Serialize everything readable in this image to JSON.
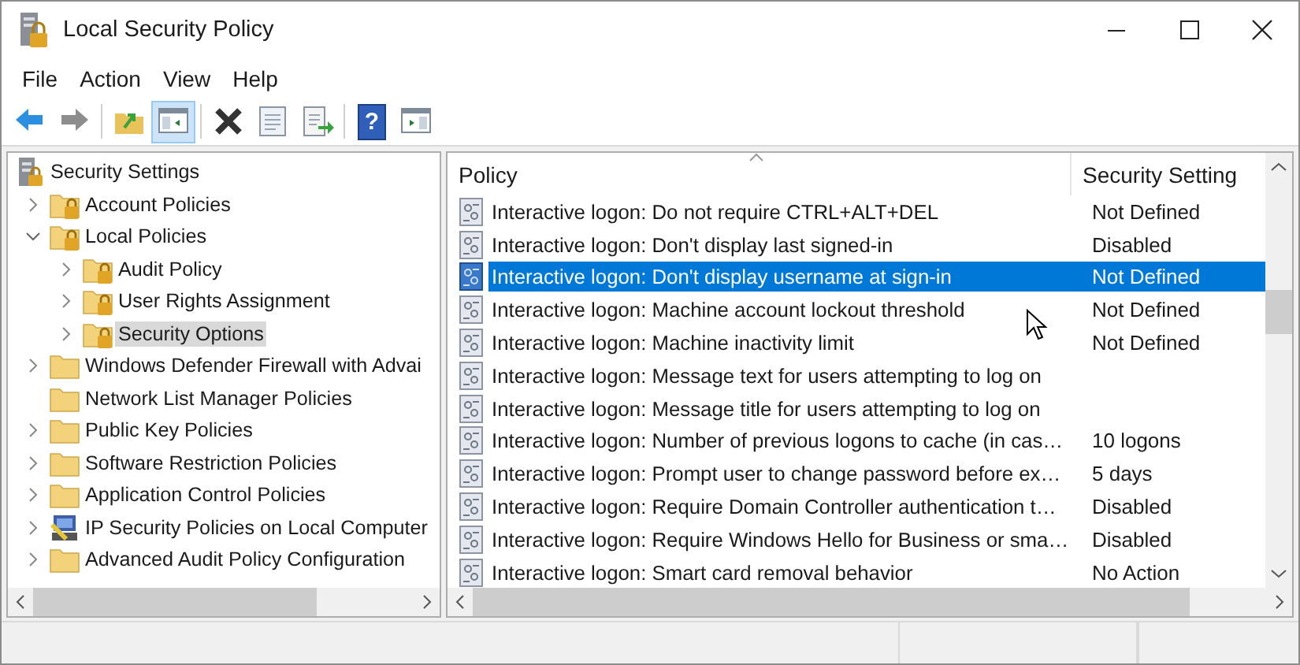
{
  "window": {
    "title": "Local Security Policy"
  },
  "menu": [
    "File",
    "Action",
    "View",
    "Help"
  ],
  "toolbar": [
    {
      "kind": "back",
      "pressed": false
    },
    {
      "kind": "forward",
      "pressed": false
    },
    {
      "kind": "sep"
    },
    {
      "kind": "up",
      "pressed": false
    },
    {
      "kind": "tree",
      "pressed": true
    },
    {
      "kind": "sep"
    },
    {
      "kind": "delete",
      "pressed": false
    },
    {
      "kind": "properties",
      "pressed": false
    },
    {
      "kind": "export",
      "pressed": false
    },
    {
      "kind": "sep"
    },
    {
      "kind": "help",
      "label": "?",
      "pressed": false
    },
    {
      "kind": "pane",
      "pressed": false
    }
  ],
  "tree": [
    {
      "label": "Security Settings",
      "kind": "root",
      "selected": false,
      "children": [
        {
          "label": "Account Policies",
          "kind": "lockfolder",
          "expanded": false,
          "selected": false
        },
        {
          "label": "Local Policies",
          "kind": "lockfolder",
          "expanded": true,
          "selected": false,
          "children": [
            {
              "label": "Audit Policy",
              "kind": "lockfolder",
              "expanded": false,
              "selected": false
            },
            {
              "label": "User Rights Assignment",
              "kind": "lockfolder",
              "expanded": false,
              "selected": false
            },
            {
              "label": "Security Options",
              "kind": "lockfolder",
              "expanded": false,
              "selected": true
            }
          ]
        },
        {
          "label": "Windows Defender Firewall with Advai",
          "kind": "folder",
          "expanded": false,
          "selected": false
        },
        {
          "label": "Network List Manager Policies",
          "kind": "folder",
          "selected": false
        },
        {
          "label": "Public Key Policies",
          "kind": "folder",
          "expanded": false,
          "selected": false
        },
        {
          "label": "Software Restriction Policies",
          "kind": "folder",
          "expanded": false,
          "selected": false
        },
        {
          "label": "Application Control Policies",
          "kind": "folder",
          "expanded": false,
          "selected": false
        },
        {
          "label": "IP Security Policies on Local Computer",
          "kind": "ipsec",
          "expanded": false,
          "selected": false
        },
        {
          "label": "Advanced Audit Policy Configuration",
          "kind": "folder",
          "expanded": false,
          "selected": false
        }
      ]
    }
  ],
  "table": {
    "columns": [
      "Policy",
      "Security Setting"
    ],
    "rows": [
      {
        "policy": "Interactive logon: Do not require CTRL+ALT+DEL",
        "setting": "Not Defined",
        "selected": false
      },
      {
        "policy": "Interactive logon: Don't display last signed-in",
        "setting": "Disabled",
        "selected": false
      },
      {
        "policy": "Interactive logon: Don't display username at sign-in",
        "setting": "Not Defined",
        "selected": true
      },
      {
        "policy": "Interactive logon: Machine account lockout threshold",
        "setting": "Not Defined",
        "selected": false
      },
      {
        "policy": "Interactive logon: Machine inactivity limit",
        "setting": "Not Defined",
        "selected": false
      },
      {
        "policy": "Interactive logon: Message text for users attempting to log on",
        "selected": false
      },
      {
        "policy": "Interactive logon: Message title for users attempting to log on",
        "selected": false
      },
      {
        "policy": "Interactive logon: Number of previous logons to cache (in cas…",
        "setting": "10 logons",
        "selected": false
      },
      {
        "policy": "Interactive logon: Prompt user to change password before ex…",
        "setting": "5 days",
        "selected": false
      },
      {
        "policy": "Interactive logon: Require Domain Controller authentication t…",
        "setting": "Disabled",
        "selected": false
      },
      {
        "policy": "Interactive logon: Require Windows Hello for Business or sma…",
        "setting": "Disabled",
        "selected": false
      },
      {
        "policy": "Interactive logon: Smart card removal behavior",
        "setting": "No Action",
        "selected": false
      }
    ]
  }
}
